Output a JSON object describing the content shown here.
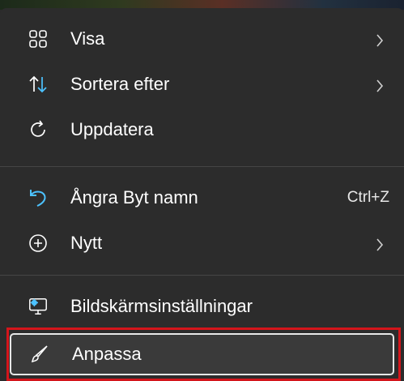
{
  "menu": {
    "items": [
      {
        "label": "Visa",
        "icon": "grid-icon",
        "submenu": true
      },
      {
        "label": "Sortera efter",
        "icon": "sort-arrows-icon",
        "submenu": true
      },
      {
        "label": "Uppdatera",
        "icon": "refresh-icon",
        "submenu": false
      },
      {
        "label": "Ångra Byt namn",
        "icon": "undo-icon",
        "shortcut": "Ctrl+Z",
        "submenu": false
      },
      {
        "label": "Nytt",
        "icon": "plus-circle-icon",
        "submenu": true
      },
      {
        "label": "Bildskärmsinställningar",
        "icon": "display-settings-icon",
        "submenu": false
      },
      {
        "label": "Anpassa",
        "icon": "brush-icon",
        "submenu": false,
        "highlighted": true
      }
    ]
  },
  "colors": {
    "menu_bg": "#2c2c2c",
    "text": "#ffffff",
    "accent_blue": "#4cc2ff",
    "highlight_frame": "#d4151b",
    "separator": "#454545"
  }
}
